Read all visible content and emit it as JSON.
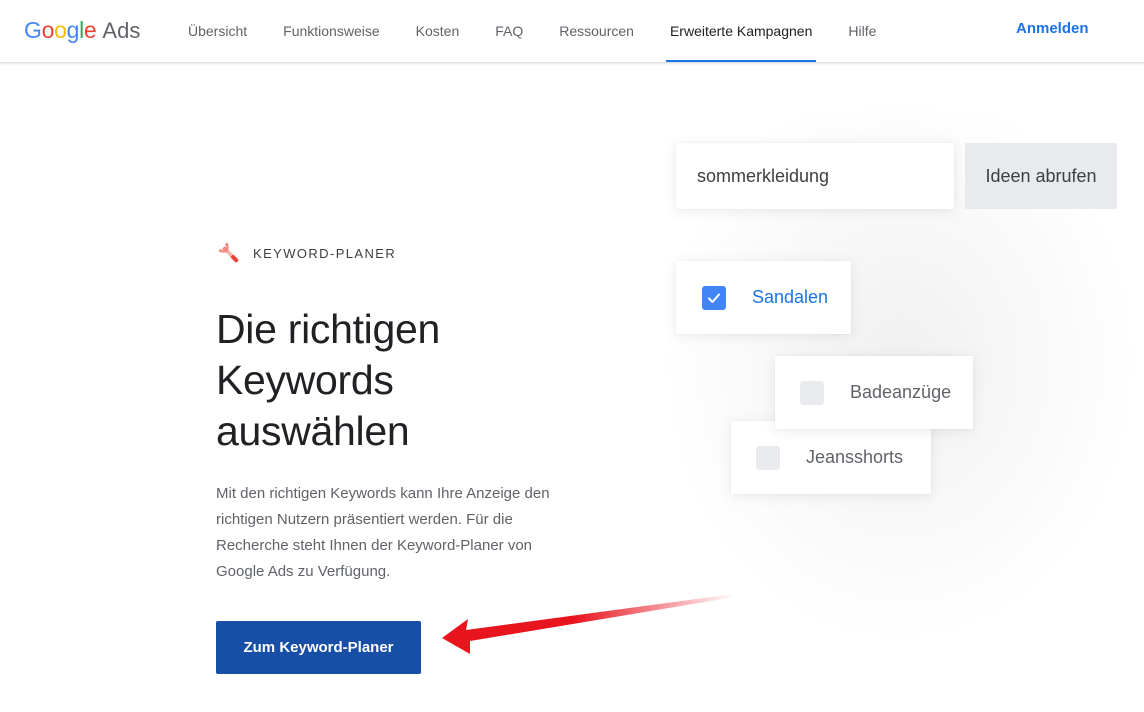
{
  "header": {
    "logo_google": "Google",
    "logo_ads": "Ads",
    "nav": [
      "Übersicht",
      "Funktionsweise",
      "Kosten",
      "FAQ",
      "Ressourcen",
      "Erweiterte Kampagnen",
      "Hilfe"
    ],
    "active_nav": "Erweiterte Kampagnen",
    "signin_label": "Anmelden"
  },
  "hero": {
    "eyebrow": "KEYWORD-PLANER",
    "headline_lines": [
      "Die richtigen",
      "Keywords",
      "auswählen"
    ],
    "body": "Mit den richtigen Keywords kann Ihre Anzeige den richtigen Nutzern präsentiert werden. Für die Recherche steht Ihnen der Keyword-Planer von Google Ads zu Verfügung.",
    "cta_label": "Zum Keyword-Planer"
  },
  "illustration": {
    "search_value": "sommerkleidung",
    "ideas_button": "Ideen abrufen",
    "keywords": [
      {
        "label": "Sandalen",
        "checked": true
      },
      {
        "label": "Badeanzüge",
        "checked": false
      },
      {
        "label": "Jeansshorts",
        "checked": false
      }
    ]
  },
  "colors": {
    "brand_blue": "#1a73e8",
    "cta_blue": "#174ea6",
    "checkbox_checked": "#4285f4",
    "annotation_arrow": "#e8141e"
  },
  "icons": {
    "eyebrow": "wrench-icon",
    "checkbox_checked": "checkmark-icon"
  }
}
